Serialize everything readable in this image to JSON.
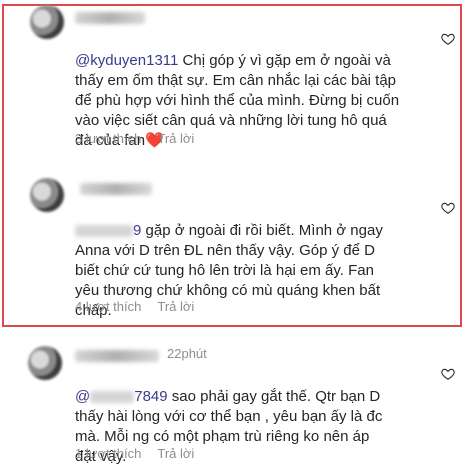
{
  "comments": [
    {
      "mention": "@kyduyen1311",
      "text": " Chị góp ý vì gặp em ở ngoài và\nthấy em ốm thật sự. Em cân nhắc lại các bài tập\nđể phù hợp với hình thể của mình. Đừng bị cuốn\nvào việc siết cân quá và những lời tung hô quá\nđà của fan",
      "emoji": "❤️",
      "likes": "3 lượt thích",
      "reply": "Trả lời"
    },
    {
      "mention_suffix": "9",
      "text": " gặp ở ngoài đi rồi biết. Mình ở ngay\nAnna với D trên ĐL nên thấy vậy. Góp ý để D\nbiết chứ cứ tung hô lên trời là hại em ấy. Fan\nyêu thương chứ không có mù quáng khen bất\nchấp.",
      "likes": "4 lượt thích",
      "reply": "Trả lời"
    },
    {
      "time": "22phút",
      "mention_prefix": "@",
      "mention_suffix": "7849",
      "text": " sao phải gay gắt thế. Qtr bạn D\nthấy hài lòng với cơ thể bạn , yêu bạn ấy là đc\nmà. Mỗi ng có một phạm trù riêng ko nên áp\nđặt vậy.",
      "likes": "1 lượt thích",
      "reply": "Trả lời"
    }
  ],
  "colors": {
    "highlight": "#e0484e",
    "meta": "#8e8e8e",
    "heart_emoji": "#e53935"
  },
  "icons": [
    "heart-outline-icon"
  ]
}
